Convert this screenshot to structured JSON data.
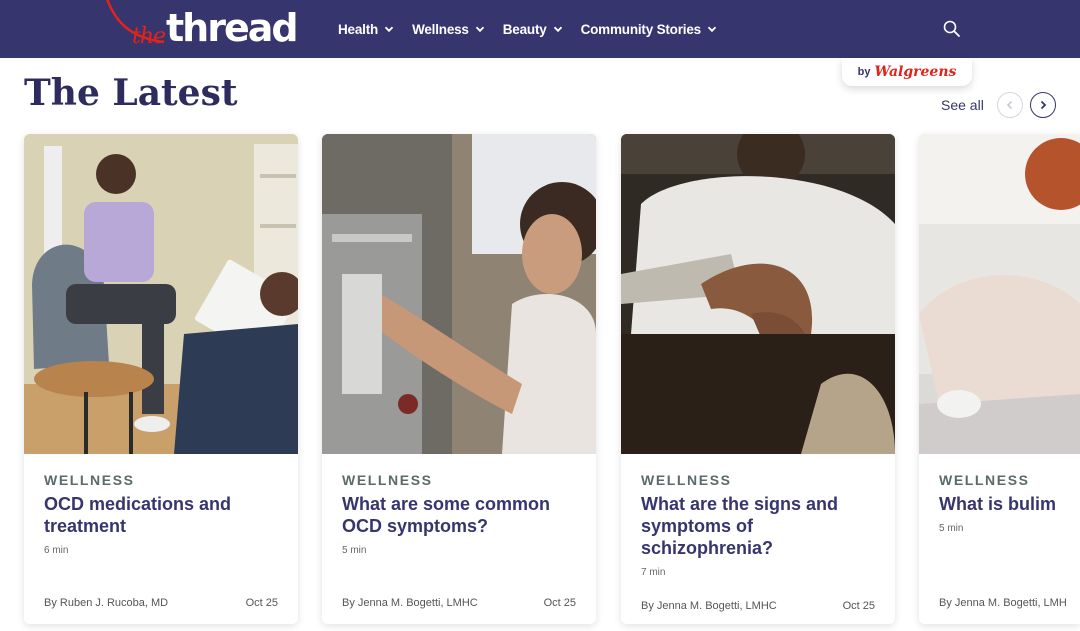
{
  "brand": {
    "logo_prefix": "the",
    "logo_word": "thread",
    "badge_by": "by",
    "badge_brand": "Walgreens"
  },
  "nav": [
    {
      "label": "Health"
    },
    {
      "label": "Wellness"
    },
    {
      "label": "Beauty"
    },
    {
      "label": "Community Stories"
    }
  ],
  "section": {
    "title": "The Latest",
    "see_all": "See all"
  },
  "cards": [
    {
      "category": "WELLNESS",
      "title": "OCD medications and treatment",
      "read_time": "6 min",
      "author": "By Ruben J. Rucoba, MD",
      "date": "Oct 25"
    },
    {
      "category": "WELLNESS",
      "title": "What are some common OCD symptoms?",
      "read_time": "5 min",
      "author": "By Jenna M. Bogetti, LMHC",
      "date": "Oct 25"
    },
    {
      "category": "WELLNESS",
      "title": "What are the signs and symptoms of schizophrenia?",
      "read_time": "7 min",
      "author": "By Jenna M. Bogetti, LMHC",
      "date": "Oct 25"
    },
    {
      "category": "WELLNESS",
      "title": "What is bulim",
      "read_time": "5 min",
      "author": "By Jenna M. Bogetti, LMH",
      "date": ""
    }
  ],
  "colors": {
    "header_bg": "#36356e",
    "accent_red": "#e2231a",
    "title_text": "#36356e"
  },
  "icons": {
    "search": "search-icon",
    "chevron": "chevron-down-icon",
    "prev": "chevron-left-icon",
    "next": "chevron-right-icon"
  }
}
